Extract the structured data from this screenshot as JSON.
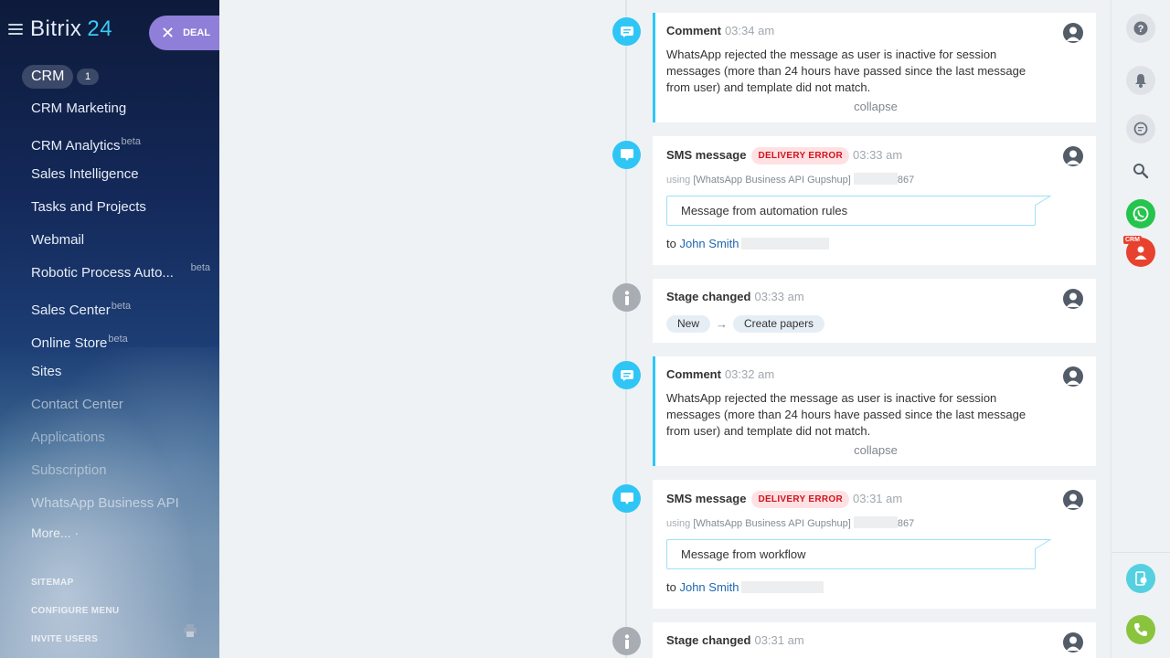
{
  "logo": {
    "name": "Bitrix",
    "num": "24"
  },
  "deal_button": "DEAL",
  "sidebar": {
    "crm_label": "CRM",
    "crm_count": "1",
    "items": [
      {
        "label": "CRM Marketing",
        "beta": ""
      },
      {
        "label": "CRM Analytics",
        "beta": "beta"
      },
      {
        "label": "Sales Intelligence",
        "beta": ""
      },
      {
        "label": "Tasks and Projects",
        "beta": ""
      },
      {
        "label": "Webmail",
        "beta": ""
      },
      {
        "label": "Robotic Process Auto...",
        "beta": "beta"
      },
      {
        "label": "Sales Center",
        "beta": "beta"
      },
      {
        "label": "Online Store",
        "beta": "beta"
      },
      {
        "label": "Sites",
        "beta": ""
      },
      {
        "label": "Contact Center",
        "beta": ""
      },
      {
        "label": "Applications",
        "beta": ""
      },
      {
        "label": "Subscription",
        "beta": ""
      },
      {
        "label": "WhatsApp Business API",
        "beta": ""
      }
    ],
    "more": "More... ·",
    "sitemap": "SITEMAP",
    "configure_menu": "CONFIGURE MENU",
    "invite_users": "INVITE USERS"
  },
  "timeline": {
    "comment1": {
      "title": "Comment",
      "time": "03:34 am",
      "text": "WhatsApp rejected the message as user is inactive for session messages (more than 24 hours have passed since the last message from user) and template did not match.",
      "collapse": "collapse"
    },
    "sms1": {
      "title": "SMS message",
      "badge": "DELIVERY ERROR",
      "time": "03:33 am",
      "using_prefix": "using",
      "provider": "[WhatsApp Business API Gupshup]",
      "number_tail": "867",
      "message": "Message from automation rules",
      "to": "to",
      "recipient": "John Smith"
    },
    "stage1": {
      "title": "Stage changed",
      "time": "03:33 am",
      "from": "New",
      "arrow": "→",
      "to": "Create papers"
    },
    "comment2": {
      "title": "Comment",
      "time": "03:32 am",
      "text": "WhatsApp rejected the message as user is inactive for session messages (more than 24 hours have passed since the last message from user) and template did not match.",
      "collapse": "collapse"
    },
    "sms2": {
      "title": "SMS message",
      "badge": "DELIVERY ERROR",
      "time": "03:31 am",
      "using_prefix": "using",
      "provider": "[WhatsApp Business API Gupshup]",
      "number_tail": "867",
      "message": "Message from workflow",
      "to": "to",
      "recipient": "John Smith"
    },
    "stage2": {
      "title": "Stage changed",
      "time": "03:31 am"
    }
  },
  "rightbar": {
    "crm_tag": "CRM",
    "icons": [
      "help-icon",
      "bell-icon",
      "chat-icon",
      "search-icon",
      "whatsapp-icon",
      "crm-contact-icon",
      "mobile-cloud-icon",
      "phone-icon"
    ]
  },
  "colors": {
    "accent": "#2fc6f6",
    "deal": "#8f7fd8",
    "error": "#d0141c",
    "whatsapp": "#25c44d",
    "phone": "#8ac43f"
  }
}
